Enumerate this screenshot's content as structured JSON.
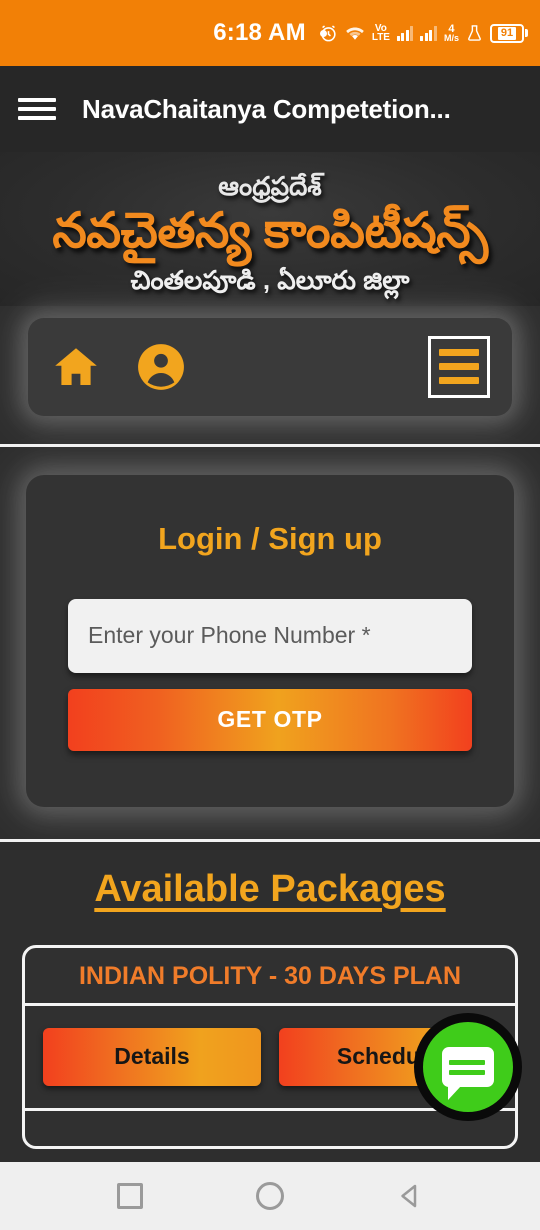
{
  "status_bar": {
    "time": "6:18 AM",
    "dot_icon": "recording-dot-icon",
    "alarm_icon": "alarm-clock-icon",
    "wifi_icon": "wifi-icon",
    "volte_line1": "Vo",
    "volte_line2": "LTE",
    "signal_icon": "signal-bars-icon",
    "net_speed_value": "4",
    "net_speed_unit": "M/s",
    "flask_icon": "flask-icon",
    "battery_level": "91",
    "background_color": "#F28006"
  },
  "app_bar": {
    "menu_icon": "hamburger-menu-icon",
    "title": "NavaChaitanya Competetion...",
    "background_color": "#272727"
  },
  "banner": {
    "top_line": "ఆంధ్రప్రదేశ్",
    "main_line": "నవచైతన్య కాంపిటీషన్స్",
    "sub_line": "చింతలపూడి , ఏలూరు జిల్లా",
    "main_color": "#F28A1E"
  },
  "nav_strip": {
    "home_icon": "home-icon",
    "profile_icon": "user-account-icon",
    "menu_icon": "hamburger-menu-icon",
    "icon_color": "#F2A51E"
  },
  "login": {
    "title": "Login / Sign up",
    "phone_placeholder": "Enter your Phone Number *",
    "phone_value": "",
    "otp_button_label": "GET OTP",
    "title_color": "#F2A51E"
  },
  "packages": {
    "heading": "Available Packages",
    "heading_color": "#F2A51E",
    "items": [
      {
        "title": "INDIAN POLITY - 30 DAYS PLAN",
        "buttons": [
          "Details",
          "Schedule"
        ]
      }
    ]
  },
  "chat_fab": {
    "icon": "chat-bubble-icon",
    "color": "#3FCC1A"
  },
  "android_nav": {
    "recents_icon": "recents-square-icon",
    "home_icon": "home-circle-icon",
    "back_icon": "back-triangle-icon",
    "background_color": "#efefef"
  }
}
